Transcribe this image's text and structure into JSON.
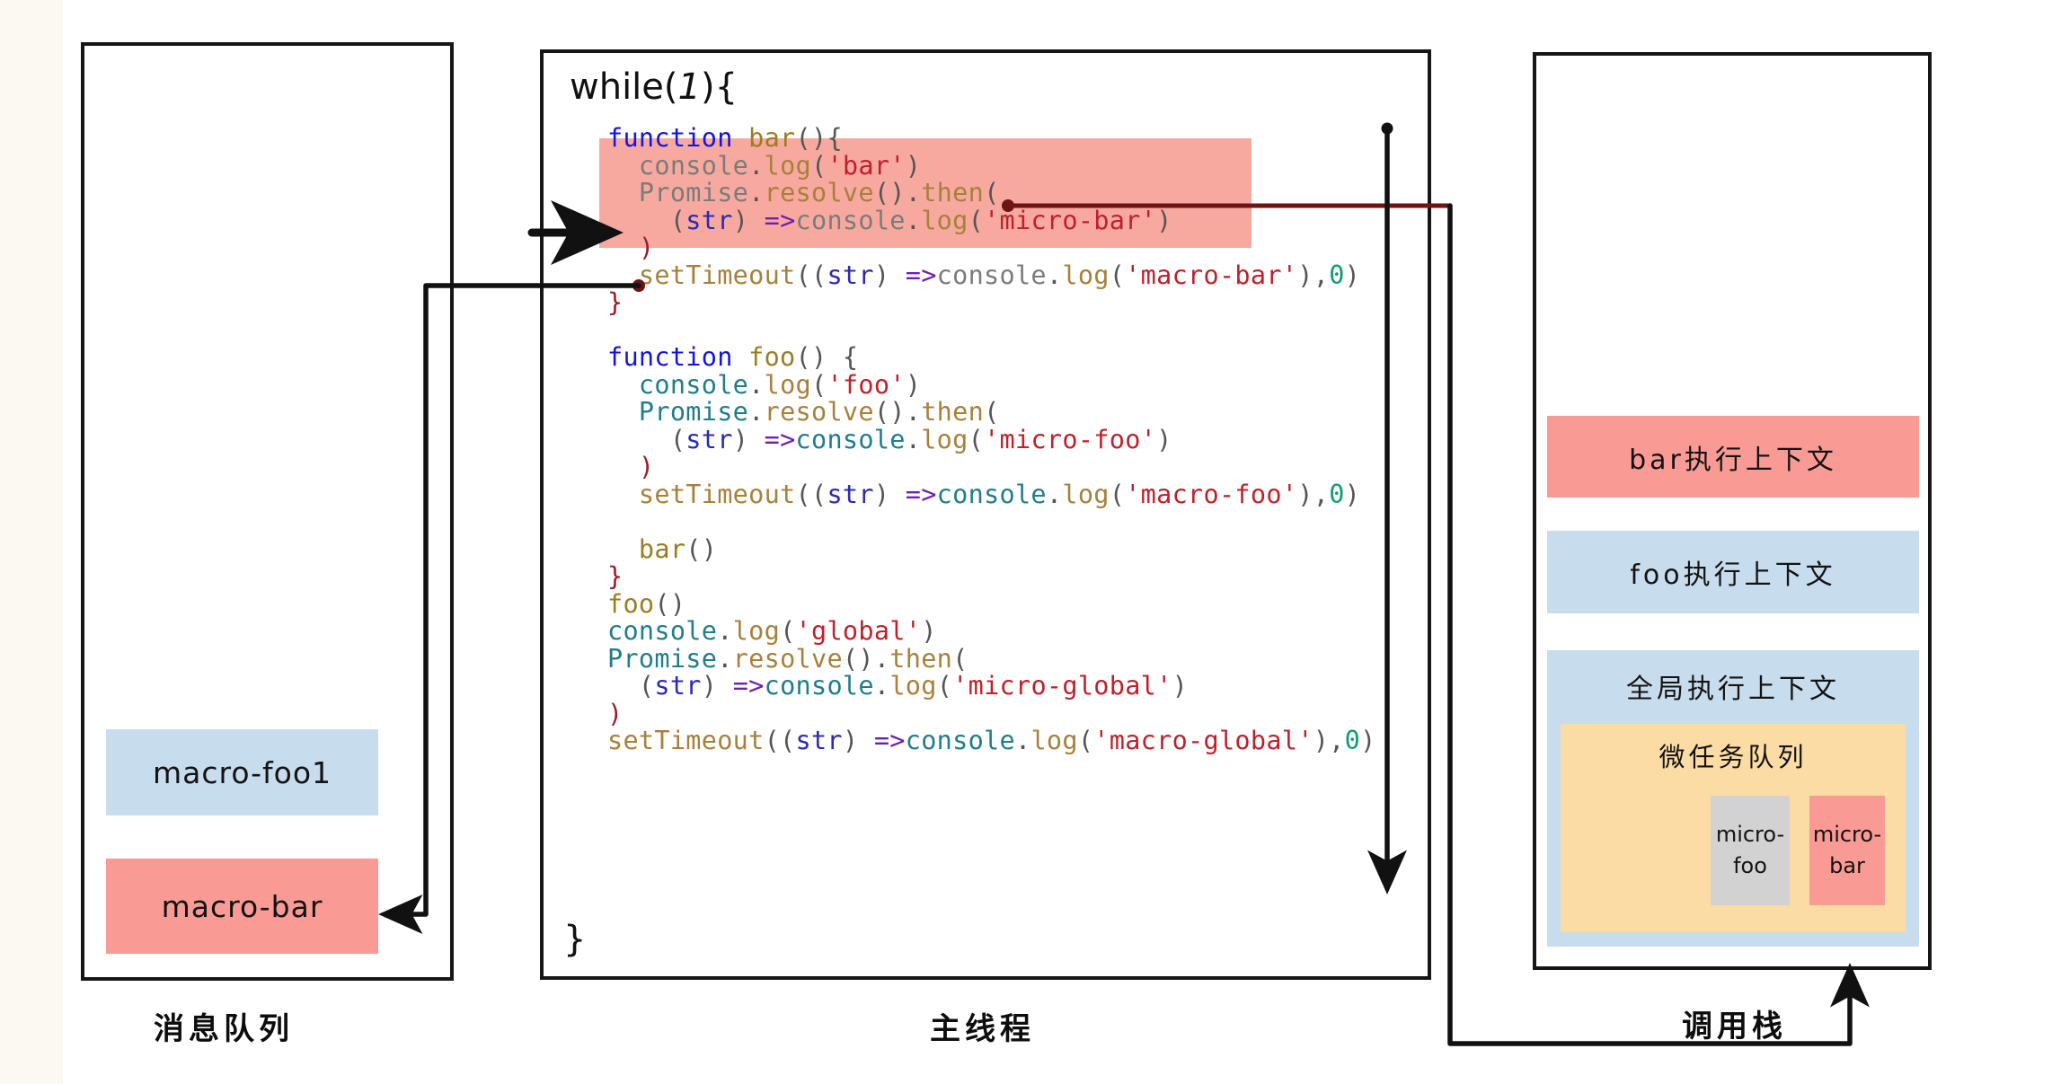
{
  "diagram": {
    "title": "JavaScript Event Loop",
    "panels": {
      "message_queue": {
        "caption": "消息队列",
        "items": [
          {
            "label": "macro-foo1",
            "color": "#c7dced"
          },
          {
            "label": "macro-bar",
            "color": "#f99b94"
          }
        ]
      },
      "main_thread": {
        "caption": "主线程",
        "loop_head": "while(",
        "loop_arg": "1",
        "loop_head_end": "){",
        "loop_tail": "}",
        "code_lines": [
          "function bar(){",
          "  console.log('bar')",
          "  Promise.resolve().then(",
          "    (str) =>console.log('micro-bar')",
          "  )",
          "  setTimeout((str) =>console.log('macro-bar'),0)",
          "}",
          "",
          "function foo() {",
          "  console.log('foo')",
          "  Promise.resolve().then(",
          "    (str) =>console.log('micro-foo')",
          "  )",
          "  setTimeout((str) =>console.log('macro-foo'),0)",
          "",
          "  bar()",
          "}",
          "foo()",
          "console.log('global')",
          "Promise.resolve().then(",
          "  (str) =>console.log('micro-global')",
          ")",
          "setTimeout((str) =>console.log('macro-global'),0)"
        ],
        "highlight_note": "bar body highlighted"
      },
      "call_stack": {
        "caption": "调用栈",
        "frames": [
          {
            "label": "bar执行上下文",
            "color": "#f99b94"
          },
          {
            "label": "foo执行上下文",
            "color": "#c7dced"
          },
          {
            "label": "全局执行上下文",
            "color": "#c7dced"
          }
        ],
        "microtask_queue": {
          "title": "微任务队列",
          "color": "#fcdca5",
          "items": [
            {
              "line1": "micro-",
              "line2": "foo",
              "color": "#d2d2d2"
            },
            {
              "line1": "micro-",
              "line2": "bar",
              "color": "#f99b94"
            }
          ]
        }
      }
    },
    "colors": {
      "red": "#f99b94",
      "blue": "#c7dced",
      "orange": "#fcdca5",
      "gray": "#d2d2d2",
      "highlight": "#f8a99f",
      "stroke": "#161616",
      "dark_red_wire": "#6d1414"
    },
    "arrows": [
      {
        "name": "execution-pointer",
        "desc": "points at bar body"
      },
      {
        "name": "then-to-callstack",
        "desc": "then( to call stack"
      },
      {
        "name": "settimeout-to-message-queue",
        "desc": "setTimeout to macro-bar"
      },
      {
        "name": "loop-down",
        "desc": "loop flow down"
      }
    ]
  }
}
